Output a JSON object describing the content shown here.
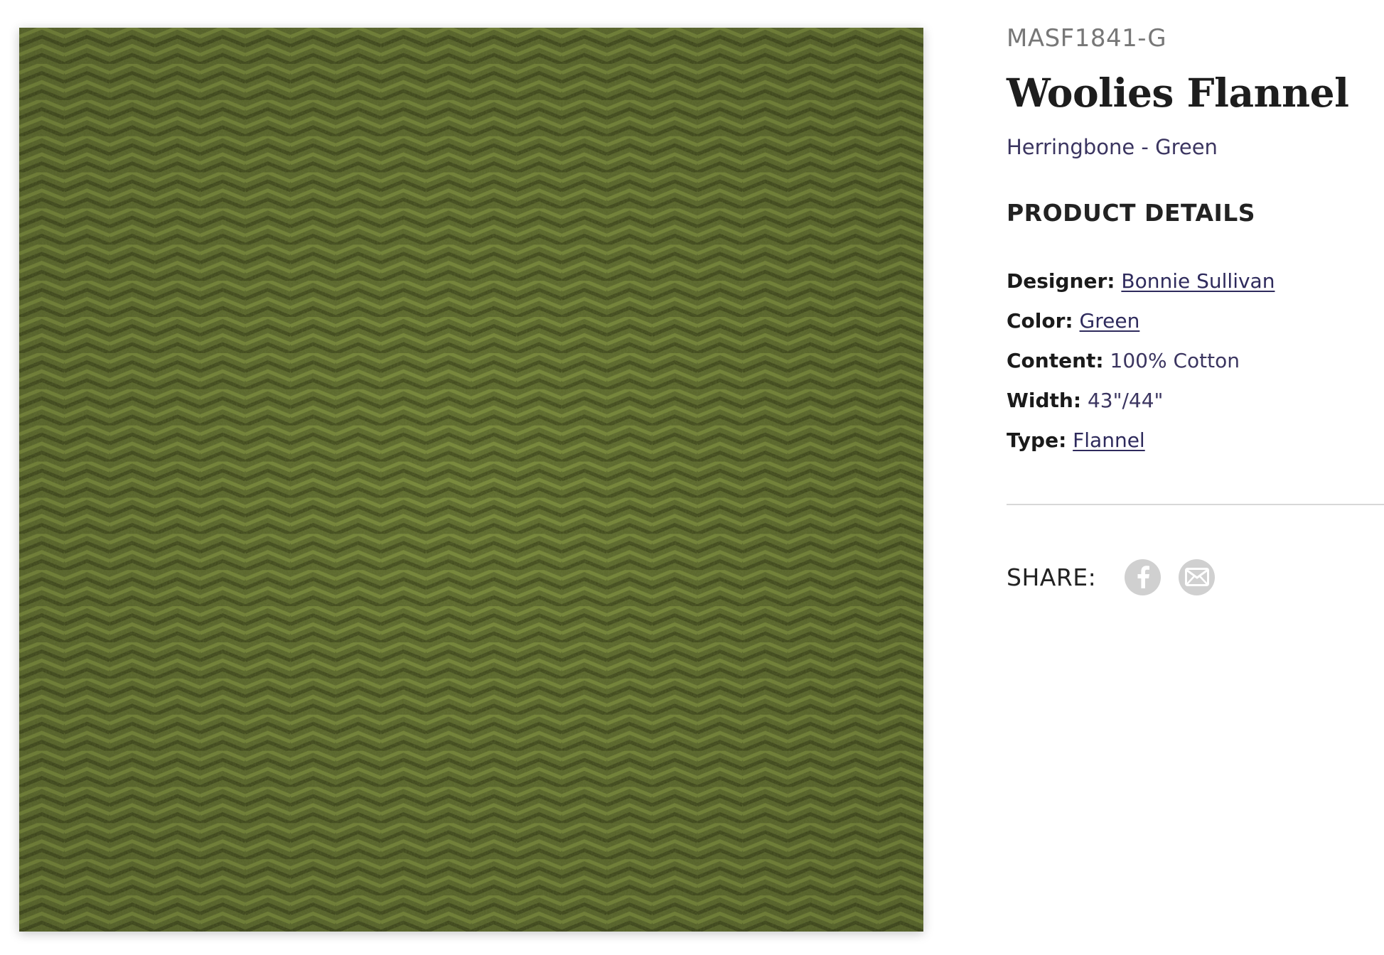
{
  "product": {
    "sku": "MASF1841-G",
    "title": "Woolies Flannel",
    "subtitle": "Herringbone - Green",
    "image": {
      "description_icon": "fabric-swatch-herringbone",
      "base_color": "#5d6a2c",
      "dark_color": "#414a1c",
      "light_color": "#7a8a3a"
    }
  },
  "details": {
    "heading": "PRODUCT DETAILS",
    "rows": [
      {
        "key": "Designer:",
        "value": "Bonnie Sullivan",
        "link": true
      },
      {
        "key": "Color:",
        "value": "Green",
        "link": true
      },
      {
        "key": "Content:",
        "value": "100% Cotton",
        "link": false
      },
      {
        "key": "Width:",
        "value": "43\"/44\"",
        "link": false
      },
      {
        "key": "Type:",
        "value": "Flannel",
        "link": true
      }
    ]
  },
  "share": {
    "label": "SHARE:",
    "buttons": [
      {
        "icon": "facebook-icon"
      },
      {
        "icon": "email-icon"
      }
    ]
  },
  "colors": {
    "link": "#2e2a5c",
    "muted_text": "#777777",
    "icon_bg": "#d0d0d0"
  }
}
